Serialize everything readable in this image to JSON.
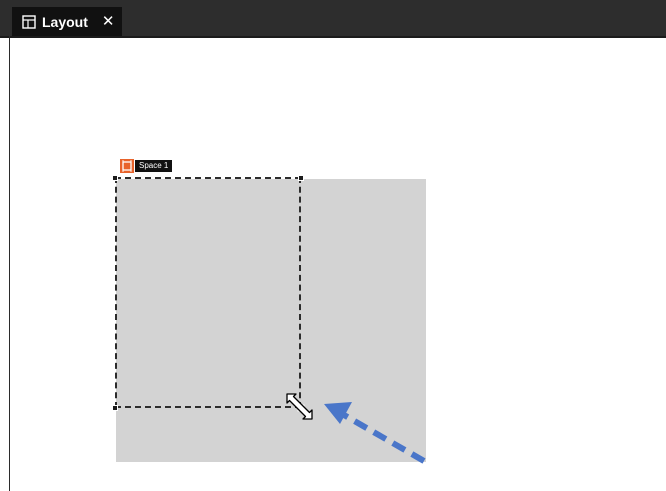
{
  "tab": {
    "label": "Layout",
    "close_glyph": "✕",
    "icon": "layout-icon"
  },
  "space": {
    "label": "Space 1",
    "icon": "space-frame-icon"
  },
  "cursor": {
    "icon": "resize-diagonal-cursor-icon"
  },
  "annotation": {
    "icon": "dashed-arrow-icon",
    "color": "#4a76c9"
  },
  "colors": {
    "tab_bar": "#2d2d2d",
    "active_tab": "#111111",
    "space_fill": "#d3d3d3",
    "space_icon": "#e8632b"
  }
}
